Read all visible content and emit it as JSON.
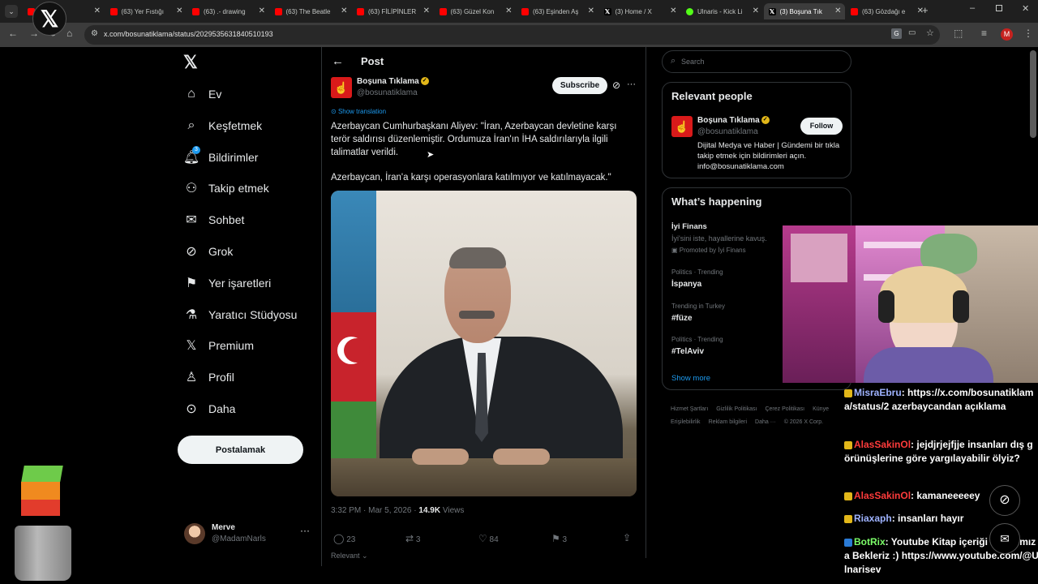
{
  "browser": {
    "tabs": [
      {
        "title": "ist | İy",
        "icon": "youtube-icon"
      },
      {
        "title": "(63) Yer Fıstığı",
        "icon": "youtube-icon"
      },
      {
        "title": "(63) .- drawing",
        "icon": "youtube-icon"
      },
      {
        "title": "(63) The Beatle",
        "icon": "youtube-icon"
      },
      {
        "title": "(63) FİLİPİNLER",
        "icon": "youtube-icon"
      },
      {
        "title": "(63) Güzel Kon",
        "icon": "youtube-icon"
      },
      {
        "title": "(63) Eşinden Aş",
        "icon": "youtube-icon"
      },
      {
        "title": "(3) Home / X",
        "icon": "x-icon"
      },
      {
        "title": "Ulnaris - Kick Li",
        "icon": "kick-icon"
      },
      {
        "title": "(3) Boşuna Tık",
        "icon": "x-icon"
      },
      {
        "title": "(63) Gözdağı e",
        "icon": "youtube-icon"
      }
    ],
    "url": "x.com/bosunatiklama/status/2029535631840510193",
    "profile_initial": "M"
  },
  "nav": {
    "items": [
      {
        "label": "Ev",
        "icon": "home-icon"
      },
      {
        "label": "Keşfetmek",
        "icon": "search-icon"
      },
      {
        "label": "Bildirimler",
        "icon": "bell-icon",
        "badge": "3"
      },
      {
        "label": "Takip etmek",
        "icon": "add-user-icon"
      },
      {
        "label": "Sohbet",
        "icon": "mail-icon"
      },
      {
        "label": "Grok",
        "icon": "grok-icon"
      },
      {
        "label": "Yer işaretleri",
        "icon": "bookmark-icon"
      },
      {
        "label": "Yaratıcı Stüdyosu",
        "icon": "flask-icon"
      },
      {
        "label": "Premium",
        "icon": "x-logo-icon"
      },
      {
        "label": "Profil",
        "icon": "person-icon"
      },
      {
        "label": "Daha",
        "icon": "more-circle-icon"
      }
    ],
    "post_button": "Postalamak",
    "account": {
      "name": "Merve",
      "handle": "@MadamNarls"
    }
  },
  "post": {
    "header": "Post",
    "author": {
      "name": "Boşuna Tıklama",
      "handle": "@bosunatiklama"
    },
    "subscribe": "Subscribe",
    "show_translation": "Show translation",
    "text_1": "Azerbaycan Cumhurbaşkanı Aliyev: \"İran, Azerbaycan devletine karşı terör saldırısı düzenlemiştir. Ordumuza İran'ın İHA saldırılarıyla ilgili talimatlar verildi.",
    "text_2": "Azerbaycan, İran'a karşı operasyonlara katılmıyor ve katılmayacak.\"",
    "time": "3:32 PM · Mar 5, 2026 ·",
    "views_count": "14.9K",
    "views_label": "Views",
    "replies": "23",
    "reposts": "3",
    "likes": "84",
    "bookmarks": "3",
    "relevant": "Relevant"
  },
  "sidebar": {
    "search_placeholder": "Search",
    "relevant_title": "Relevant people",
    "person": {
      "name": "Boşuna Tıklama",
      "handle": "@bosunatiklama",
      "follow": "Follow",
      "bio": "Dijital Medya ve Haber | Gündemi bir tıkla takip etmek için bildirimleri açın. info@bosunatiklama.com"
    },
    "happening_title": "What’s happening",
    "promo": {
      "title": "İyi Finans",
      "subtitle": "İyi'sini iste, hayallerine kavuş.",
      "promoted": "Promoted by İyi Finans"
    },
    "trends": [
      {
        "context": "Politics · Trending",
        "name": "İspanya"
      },
      {
        "context": "Trending in Turkey",
        "name": "#füze"
      },
      {
        "context": "Politics · Trending",
        "name": "#TelAviv"
      }
    ],
    "show_more": "Show more",
    "footer": [
      "Hizmet Şartları",
      "Gizlilik Politikası",
      "Çerez Politikası",
      "Künye",
      "Erişilebilirlik",
      "Reklam bilgileri",
      "Daha ···",
      "© 2026 X Corp."
    ]
  },
  "chat": [
    {
      "user": "MisraEbru",
      "message": "https://x.com/bosunatiklama/status/2 azerbaycandan açıklama"
    },
    {
      "user": "AlasSakinOl",
      "message": "jejdjrjejfjje insanları dış görünüşlerine göre yargılayabilir ölyiz?"
    },
    {
      "user": "AlasSakinOl",
      "message": "kamaneeeeey"
    },
    {
      "user": "Riaxaph",
      "message": "insanları hayır"
    },
    {
      "user": "BotRix",
      "message": "Youtube Kitap içeriği Kanalımıza Bekleriz :) https://www.youtube.com/@Ulnarisev"
    }
  ],
  "colors": {
    "x_blue": "#1d9bf0",
    "verified_gold": "#e2b719",
    "brand_red": "#d91a1a",
    "youtube_red": "#ff0000"
  }
}
